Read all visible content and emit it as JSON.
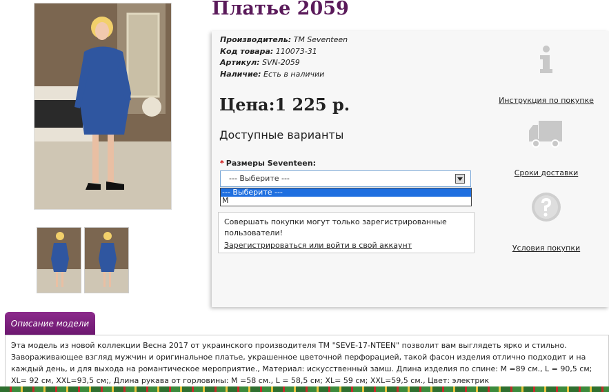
{
  "product": {
    "title": "Платье 2059",
    "specs": [
      {
        "label": "Производитель:",
        "value": "ТМ Seventeen"
      },
      {
        "label": "Код товара:",
        "value": "110073-31"
      },
      {
        "label": "Артикул:",
        "value": "SVN-2059"
      },
      {
        "label": "Наличие:",
        "value": "Есть в наличии"
      }
    ],
    "price": "Цена:1 225 р.",
    "variants_title": "Доступные варианты",
    "size_label": "Размеры Seventeen:",
    "size_required_mark": "*",
    "select": {
      "value": "--- Выберите ---",
      "options": [
        "--- Выберите ---",
        "M"
      ]
    }
  },
  "notice": {
    "text": "Совершать покупки могут только зарегистрированные пользователи!",
    "link": "Зарегистрироваться или войти в свой аккаунт"
  },
  "info_links": [
    {
      "label": "Инструкция по покупке",
      "icon": "info-icon"
    },
    {
      "label": "Сроки доставки",
      "icon": "truck-icon"
    },
    {
      "label": "Условия покупки",
      "icon": "question-icon"
    }
  ],
  "description": {
    "tab_label": "Описание модели",
    "text": "Эта модель из новой коллекции Весна 2017 от украинского производителя ТМ \"SEVE-17-NTEEN\" позволит вам выглядеть ярко и стильно. Завораживающее взгляд мужчин и оригинальное платье, украшенное цветочной перфорацией, такой фасон изделия отлично подходит и на каждый день, и для выхода на романтическое мероприятие., Материал: искусственный замш. Длина изделия по спине: M =89 см., L = 90,5 см; XL= 92 см, XXL=93,5 см;, Длина рукава от горловины: M =58 см., L = 58,5 см; XL= 59 см; XXL=59,5 см., Цвет: электрик"
  },
  "colors": {
    "title": "#5a1a5a",
    "tab": "#7a1f7d",
    "dress": "#2f56a0",
    "select_highlight": "#1e6fe0"
  }
}
